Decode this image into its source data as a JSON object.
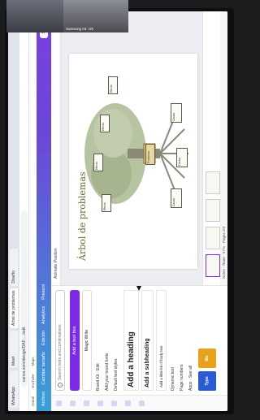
{
  "browser": {
    "tabs": [
      "WhatsApp",
      "Meet",
      "Árbol de problemas",
      "Diseño"
    ],
    "address": "canva.com/design/DAF...../edit",
    "bookmarks": [
      "Gmail",
      "YouTube",
      "Maps"
    ]
  },
  "canva": {
    "menu": [
      "Archivo",
      "Cambiar tamaño",
      "Edición"
    ],
    "share_label": "Share",
    "present_label": "Present",
    "analytics_label": "Analytics",
    "rail": [
      "Design",
      "Elements",
      "Text",
      "Brand",
      "Uploads",
      "Draw",
      "Apps"
    ],
    "search_placeholder": "Search fonts and combinations",
    "add_text_box": "Add a text box",
    "magic_write": "Magic Write",
    "brand_kit": "Brand Kit",
    "edit": "Edit",
    "add_brand_fonts": "Add your brand fonts",
    "default_styles": "Default text styles",
    "heading": "Add a heading",
    "subheading": "Add a subheading",
    "body": "Add a little bit of body text",
    "dynamic_text": "Dynamic text",
    "page_numbers": "Page numbers",
    "apps": "Apps",
    "see_all": "See all",
    "thumb1": "Type GRAD",
    "thumb2": "Mo",
    "toolbar_label": "Animate   Position",
    "page_title": "Árbol de problemas",
    "notes": "Notes",
    "timer": "Timer",
    "zoom": "57%",
    "pages": "Pages 2/4",
    "boxes": [
      "Efecto",
      "Efecto",
      "Efecto",
      "Efecto",
      "Causa",
      "Causa",
      "Causa",
      "Problema"
    ]
  },
  "video": {
    "p1": "",
    "p2": "Samsung Int. UX"
  }
}
